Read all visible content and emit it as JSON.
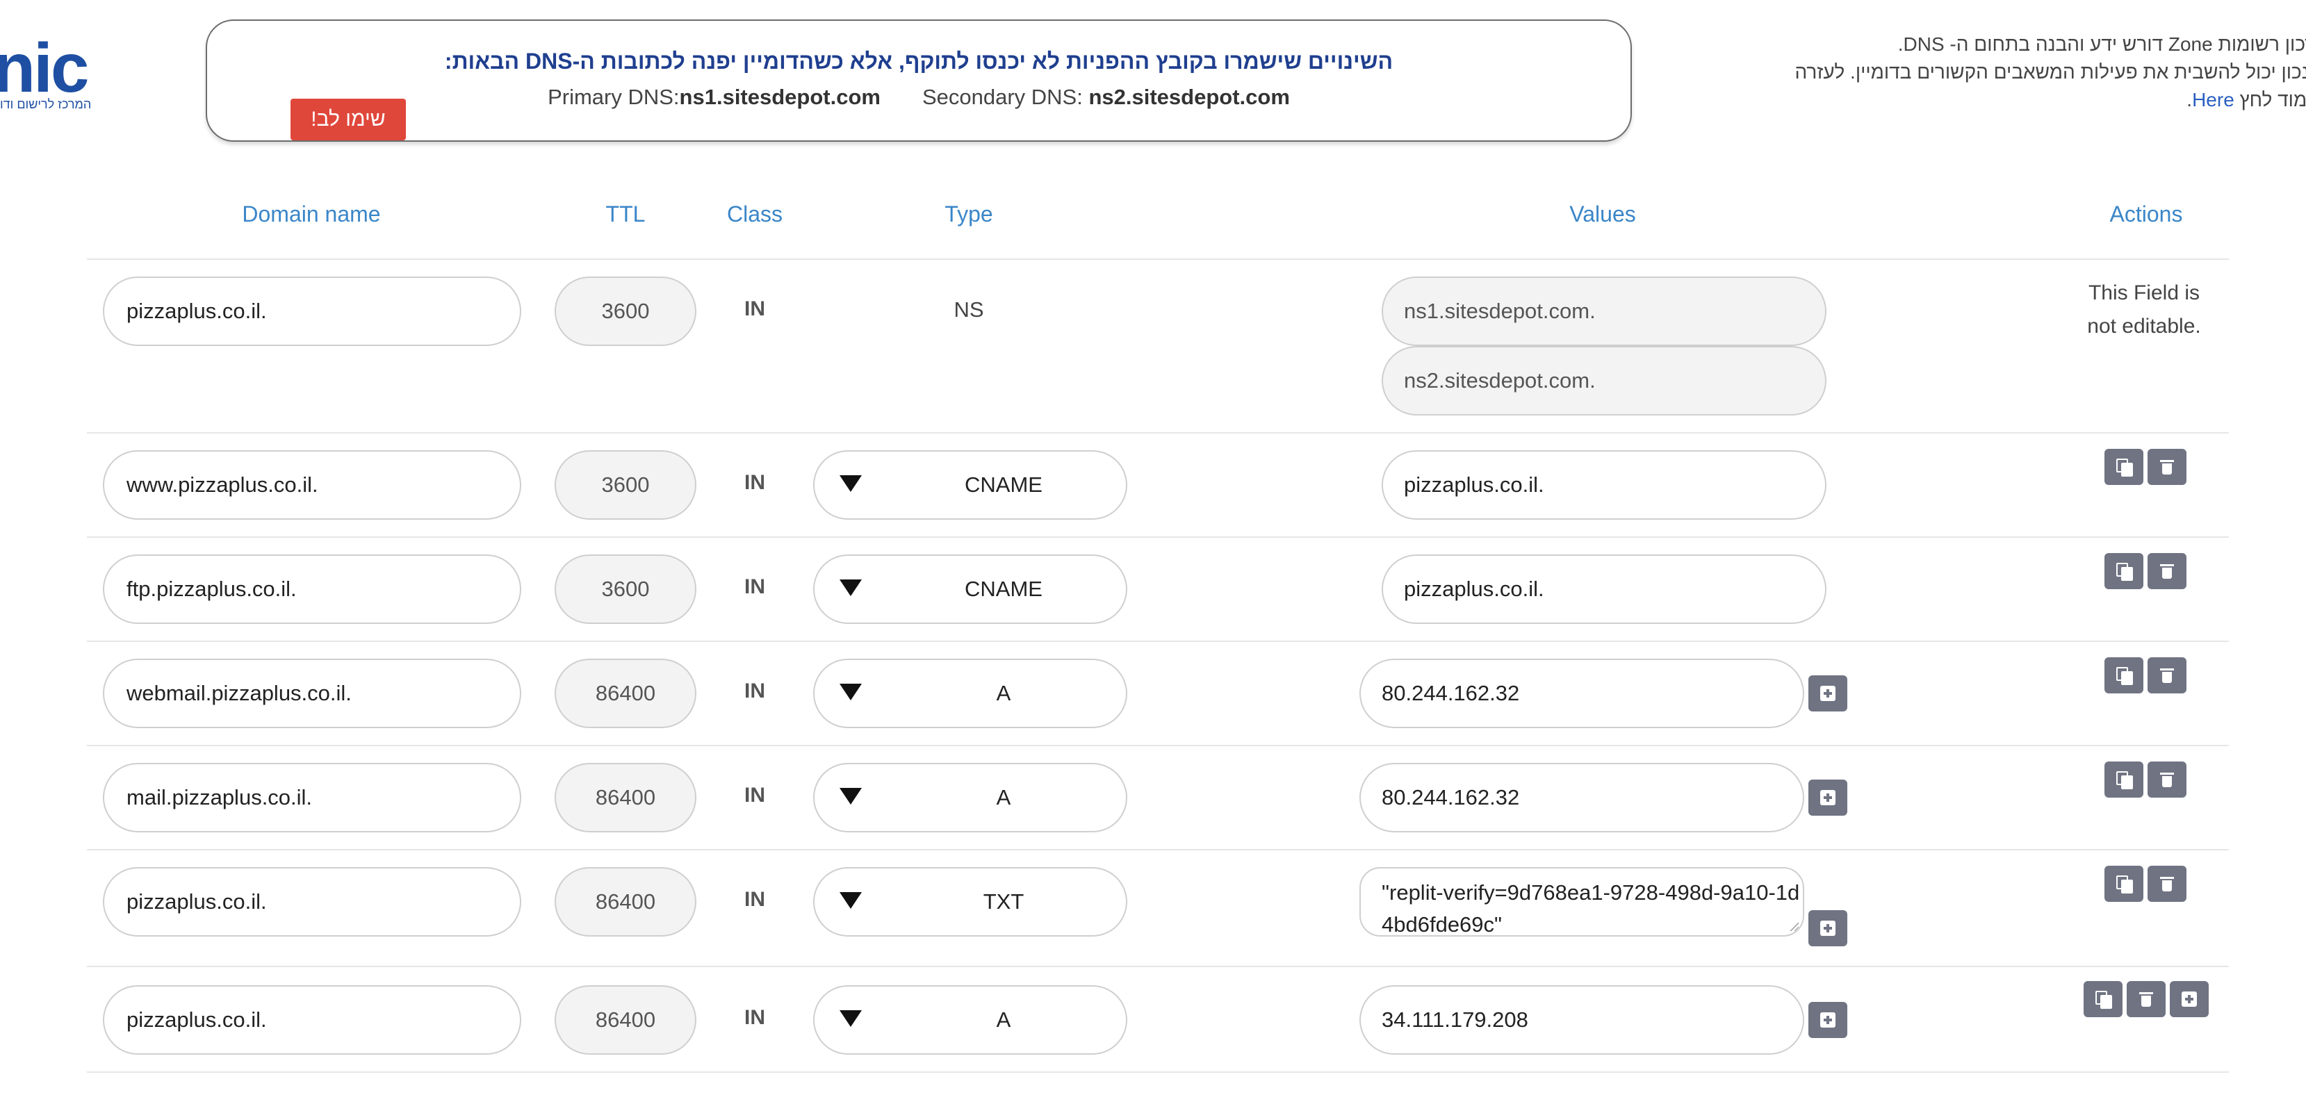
{
  "logo": {
    "text": "nic",
    "tagline": "המרכז לרישום ודו"
  },
  "notice": {
    "warning": "השינויים שישמרו בקובץ ההפניות לא יכנסו לתוקף, אלא כשהדומיין יפנה לכתובות ה-DNS הבאות:",
    "primary_label": "Primary DNS:",
    "primary_value": "ns1.sitesdepot.com",
    "secondary_label": "Secondary DNS: ",
    "secondary_value": "ns2.sitesdepot.com",
    "button_label": "שימו לב!"
  },
  "info": {
    "line1": "עדכון רשומות Zone דורש ידע והבנה בתחום ה- DNS.",
    "line2": "א נכון יכול להשבית את פעילות המשאבים הקשורים בדומיין. לעזרה",
    "line3": "ולימוד לחץ ",
    "link": "Here",
    "line3_end": "."
  },
  "columns": {
    "domain": "Domain name",
    "ttl": "TTL",
    "class": "Class",
    "type": "Type",
    "values": "Values",
    "actions": "Actions"
  },
  "rows": [
    {
      "name": "pizzaplus.co.il.",
      "ttl": "3600",
      "class": "IN",
      "type": "NS",
      "values": [
        "ns1.sitesdepot.com.",
        "ns2.sitesdepot.com."
      ],
      "actions_text_1": "This Field is",
      "actions_text_2": "not editable."
    },
    {
      "name": "www.pizzaplus.co.il.",
      "ttl": "3600",
      "class": "IN",
      "type": "CNAME",
      "value": "pizzaplus.co.il."
    },
    {
      "name": "ftp.pizzaplus.co.il.",
      "ttl": "3600",
      "class": "IN",
      "type": "CNAME",
      "value": "pizzaplus.co.il."
    },
    {
      "name": "webmail.pizzaplus.co.il.",
      "ttl": "86400",
      "class": "IN",
      "type": "A",
      "value": "80.244.162.32"
    },
    {
      "name": "mail.pizzaplus.co.il.",
      "ttl": "86400",
      "class": "IN",
      "type": "A",
      "value": "80.244.162.32"
    },
    {
      "name": "pizzaplus.co.il.",
      "ttl": "86400",
      "class": "IN",
      "type": "TXT",
      "value": "\"replit-verify=9d768ea1-9728-498d-9a10-1d4bd6fde69c\""
    },
    {
      "name": "pizzaplus.co.il.",
      "ttl": "86400",
      "class": "IN",
      "type": "A",
      "value": "34.111.179.208"
    }
  ],
  "icons": {
    "copy": "copy-icon",
    "delete": "trash-icon",
    "add": "plus-square-icon",
    "dropdown": "caret-down-icon"
  }
}
